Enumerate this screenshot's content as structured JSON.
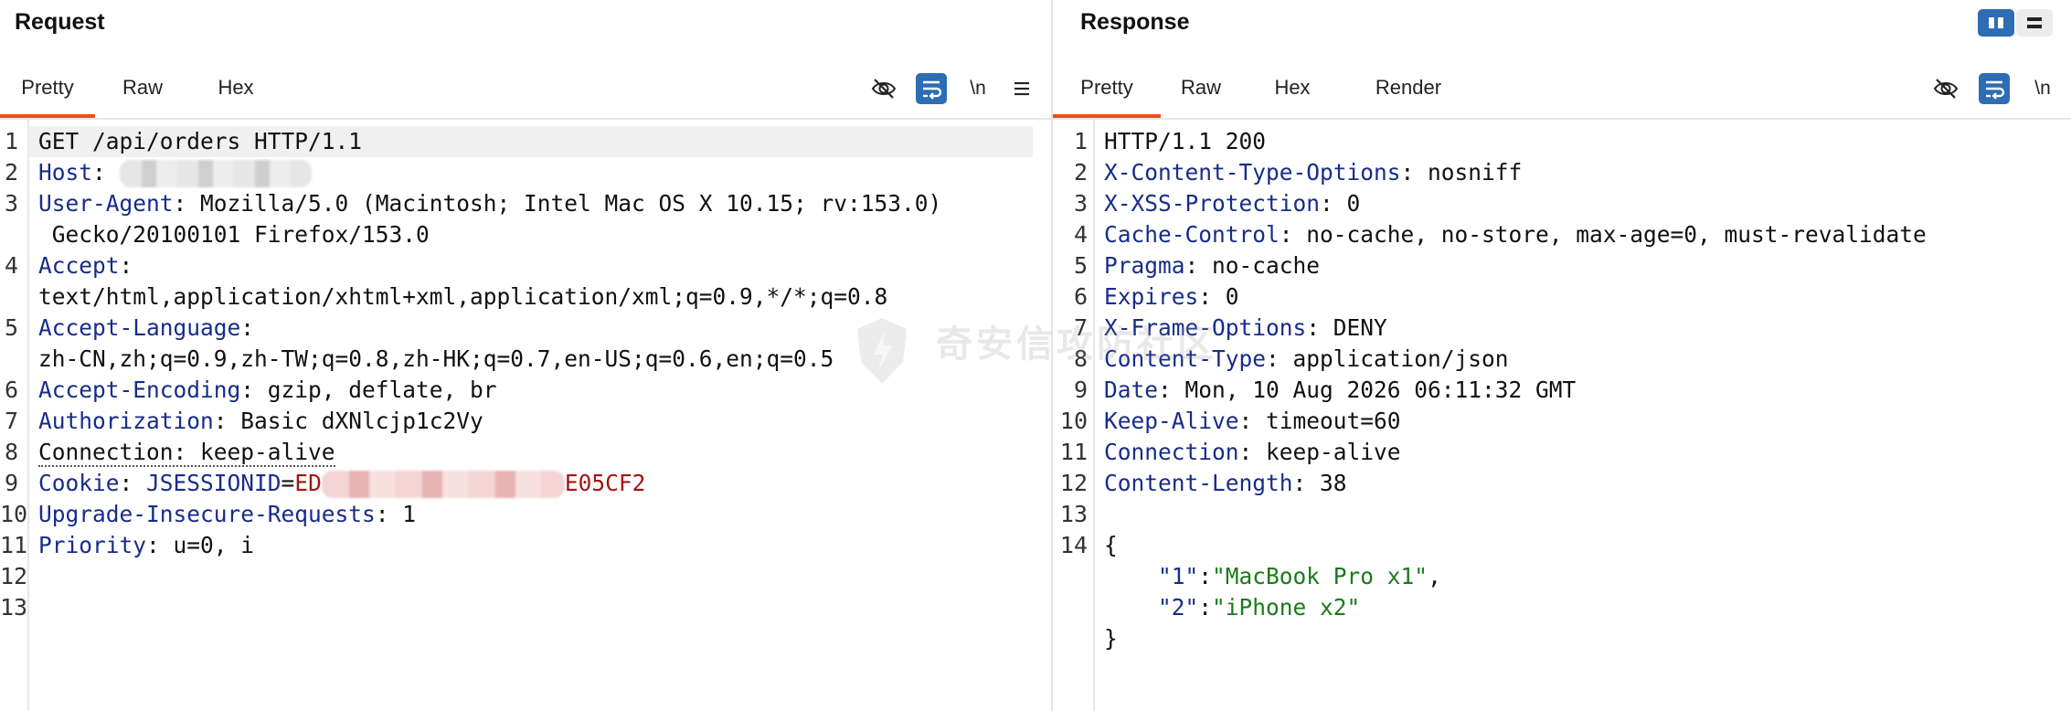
{
  "request": {
    "title": "Request",
    "tabs": [
      "Pretty",
      "Raw",
      "Hex"
    ],
    "newline_label": "\\n",
    "lines": [
      {
        "n": "1",
        "segments": [
          {
            "t": "GET /api/orders HTTP/1.1",
            "c": "v"
          }
        ]
      },
      {
        "n": "2",
        "segments": [
          {
            "t": "Host",
            "c": "k"
          },
          {
            "t": ": ",
            "c": "v"
          }
        ],
        "redacted": "host"
      },
      {
        "n": "3",
        "segments": [
          {
            "t": "User-Agent",
            "c": "k"
          },
          {
            "t": ": Mozilla/5.0 (Macintosh; Intel Mac OS X 10.15; rv:153.0)",
            "c": "v"
          }
        ]
      },
      {
        "n": "",
        "segments": [
          {
            "t": " Gecko/20100101 Firefox/153.0",
            "c": "v"
          }
        ]
      },
      {
        "n": "4",
        "segments": [
          {
            "t": "Accept",
            "c": "k"
          },
          {
            "t": ":",
            "c": "v"
          }
        ]
      },
      {
        "n": "",
        "segments": [
          {
            "t": "text/html,application/xhtml+xml,application/xml;q=0.9,*/*;q=0.8",
            "c": "v"
          }
        ]
      },
      {
        "n": "5",
        "segments": [
          {
            "t": "Accept-Language",
            "c": "k"
          },
          {
            "t": ":",
            "c": "v"
          }
        ]
      },
      {
        "n": "",
        "segments": [
          {
            "t": "zh-CN,zh;q=0.9,zh-TW;q=0.8,zh-HK;q=0.7,en-US;q=0.6,en;q=0.5",
            "c": "v"
          }
        ]
      },
      {
        "n": "6",
        "segments": [
          {
            "t": "Accept-Encoding",
            "c": "k"
          },
          {
            "t": ": gzip, deflate, br",
            "c": "v"
          }
        ]
      },
      {
        "n": "7",
        "segments": [
          {
            "t": "Authorization",
            "c": "k"
          },
          {
            "t": ": Basic dXNlcjp1c2Vy",
            "c": "v"
          }
        ]
      },
      {
        "n": "8",
        "segments": [
          {
            "t": "Connection: keep-alive",
            "c": "dotted"
          }
        ]
      },
      {
        "n": "9",
        "segments": [
          {
            "t": "Cookie",
            "c": "k"
          },
          {
            "t": ": ",
            "c": "v"
          },
          {
            "t": "JSESSIONID",
            "c": "k"
          },
          {
            "t": "=",
            "c": "v"
          },
          {
            "t": "ED",
            "c": "red"
          }
        ],
        "redacted": "cookie",
        "after": [
          {
            "t": "E05CF2",
            "c": "red"
          }
        ]
      },
      {
        "n": "10",
        "segments": [
          {
            "t": "Upgrade-Insecure-Requests",
            "c": "k"
          },
          {
            "t": ": 1",
            "c": "v"
          }
        ]
      },
      {
        "n": "11",
        "segments": [
          {
            "t": "Priority",
            "c": "k"
          },
          {
            "t": ": u=0, i",
            "c": "v"
          }
        ]
      },
      {
        "n": "12",
        "segments": []
      },
      {
        "n": "13",
        "segments": []
      }
    ]
  },
  "response": {
    "title": "Response",
    "tabs": [
      "Pretty",
      "Raw",
      "Hex",
      "Render"
    ],
    "newline_label": "\\n",
    "lines": [
      {
        "n": "1",
        "segments": [
          {
            "t": "HTTP/1.1 200",
            "c": "v"
          }
        ]
      },
      {
        "n": "2",
        "segments": [
          {
            "t": "X-Content-Type-Options",
            "c": "k"
          },
          {
            "t": ": nosniff",
            "c": "v"
          }
        ]
      },
      {
        "n": "3",
        "segments": [
          {
            "t": "X-XSS-Protection",
            "c": "k"
          },
          {
            "t": ": 0",
            "c": "v"
          }
        ]
      },
      {
        "n": "4",
        "segments": [
          {
            "t": "Cache-Control",
            "c": "k"
          },
          {
            "t": ": no-cache, no-store, max-age=0, must-revalidate",
            "c": "v"
          }
        ]
      },
      {
        "n": "5",
        "segments": [
          {
            "t": "Pragma",
            "c": "k"
          },
          {
            "t": ": no-cache",
            "c": "v"
          }
        ]
      },
      {
        "n": "6",
        "segments": [
          {
            "t": "Expires",
            "c": "k"
          },
          {
            "t": ": 0",
            "c": "v"
          }
        ]
      },
      {
        "n": "7",
        "segments": [
          {
            "t": "X-Frame-Options",
            "c": "k"
          },
          {
            "t": ": DENY",
            "c": "v"
          }
        ]
      },
      {
        "n": "8",
        "segments": [
          {
            "t": "Content-Type",
            "c": "k"
          },
          {
            "t": ": application/json",
            "c": "v"
          }
        ]
      },
      {
        "n": "9",
        "segments": [
          {
            "t": "Date",
            "c": "k"
          },
          {
            "t": ": Mon, 10 Aug 2026 06:11:32 GMT",
            "c": "v"
          }
        ]
      },
      {
        "n": "10",
        "segments": [
          {
            "t": "Keep-Alive",
            "c": "k"
          },
          {
            "t": ": timeout=60",
            "c": "v"
          }
        ]
      },
      {
        "n": "11",
        "segments": [
          {
            "t": "Connection",
            "c": "k"
          },
          {
            "t": ": keep-alive",
            "c": "v"
          }
        ]
      },
      {
        "n": "12",
        "segments": [
          {
            "t": "Content-Length",
            "c": "k"
          },
          {
            "t": ": 38",
            "c": "v"
          }
        ]
      },
      {
        "n": "13",
        "segments": []
      },
      {
        "n": "14",
        "segments": [
          {
            "t": "{",
            "c": "v"
          }
        ]
      },
      {
        "n": "",
        "segments": [
          {
            "t": "    ",
            "c": "v"
          },
          {
            "t": "\"1\"",
            "c": "k"
          },
          {
            "t": ":",
            "c": "v"
          },
          {
            "t": "\"MacBook Pro x1\"",
            "c": "str"
          },
          {
            "t": ",",
            "c": "v"
          }
        ]
      },
      {
        "n": "",
        "segments": [
          {
            "t": "    ",
            "c": "v"
          },
          {
            "t": "\"2\"",
            "c": "k"
          },
          {
            "t": ":",
            "c": "v"
          },
          {
            "t": "\"iPhone x2\"",
            "c": "str"
          }
        ]
      },
      {
        "n": "",
        "segments": [
          {
            "t": "}",
            "c": "v"
          }
        ]
      }
    ]
  },
  "watermark": "奇安信攻防社区",
  "colors": {
    "accent": "#e8501b",
    "button_blue": "#2d6db5",
    "header_key": "#172c8a",
    "string": "#1b7a1b",
    "cookie_value": "#a31515"
  }
}
